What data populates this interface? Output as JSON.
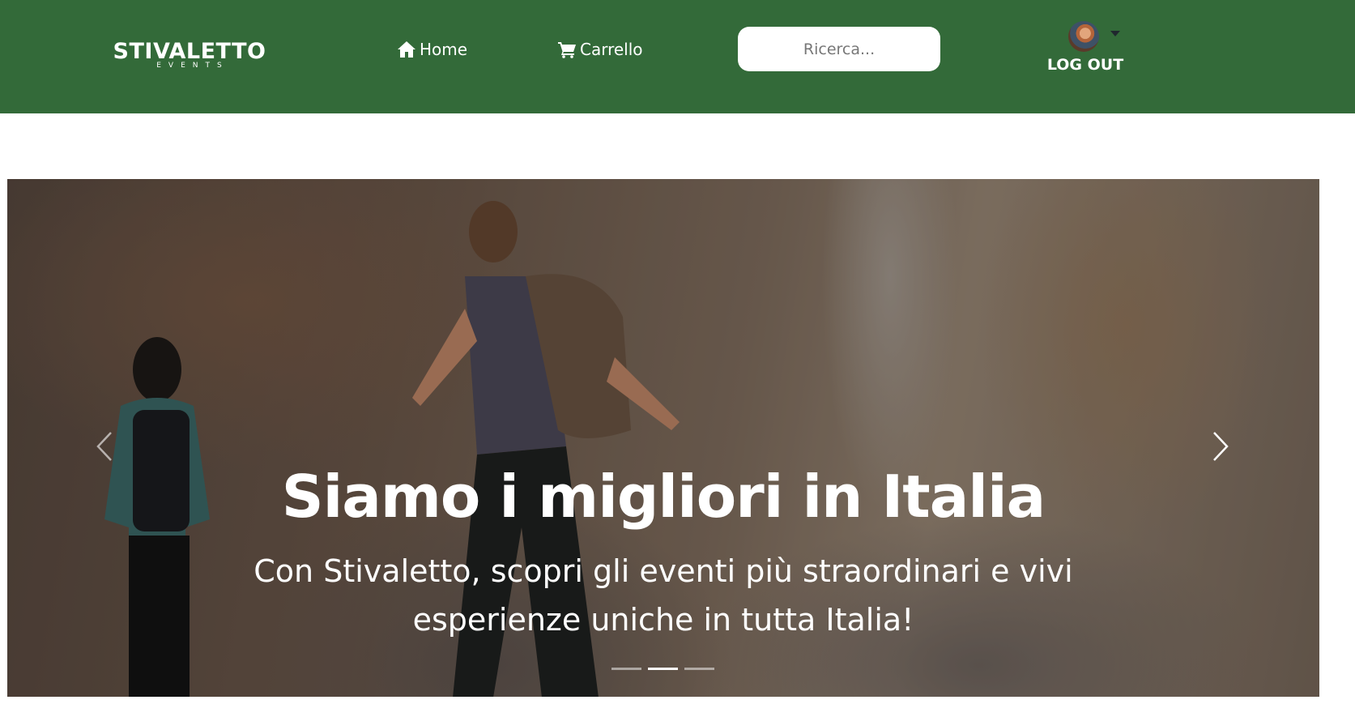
{
  "brand": {
    "name": "STIVALETTO",
    "subtitle": "EVENTS"
  },
  "nav": {
    "home_label": "Home",
    "cart_label": "Carrello"
  },
  "search": {
    "placeholder": "Ricerca...",
    "value": ""
  },
  "user": {
    "logout_label": "LOG OUT"
  },
  "carousel": {
    "title": "Siamo i migliori in Italia",
    "subtitle": "Con Stivaletto, scopri gli eventi più straordinari e vivi esperienze uniche in tutta Italia!",
    "slide_count": 3,
    "active_index": 1
  },
  "colors": {
    "navbar": "#336a39",
    "text_light": "#ffffff"
  }
}
